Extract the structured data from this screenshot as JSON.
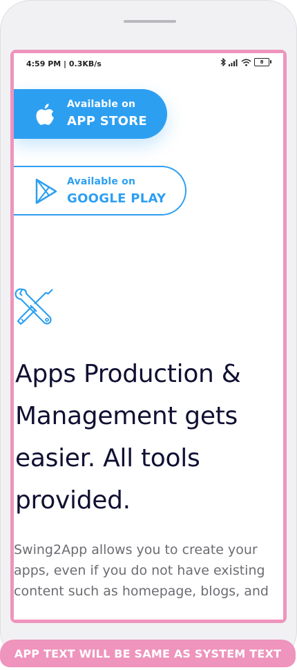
{
  "status_bar": {
    "time": "4:59 PM | 0.3KB/s",
    "battery": "8",
    "icons": [
      "bluetooth-icon",
      "signal-icon",
      "wifi-icon",
      "battery-icon"
    ]
  },
  "store_buttons": {
    "app_store": {
      "small": "Available on",
      "big": "APP STORE",
      "icon": "apple-icon"
    },
    "google_play": {
      "small": "Available on",
      "big": "GOOGLE PLAY",
      "icon": "play-icon"
    }
  },
  "feature": {
    "icon": "tools-icon",
    "headline_lines": [
      "Apps Production &",
      "Management gets",
      "easier. All tools",
      "provided."
    ],
    "body_lines": [
      "Swing2App allows you to create your",
      "apps, even if you do not have existing",
      "content such as homepage, blogs, and"
    ]
  },
  "banner": {
    "text": "APP TEXT WILL BE SAME AS SYSTEM TEXT"
  },
  "colors": {
    "accent": "#2d9ff1",
    "frame_pink": "#ee94bd",
    "headline": "#101033",
    "body": "#6b6b72"
  }
}
